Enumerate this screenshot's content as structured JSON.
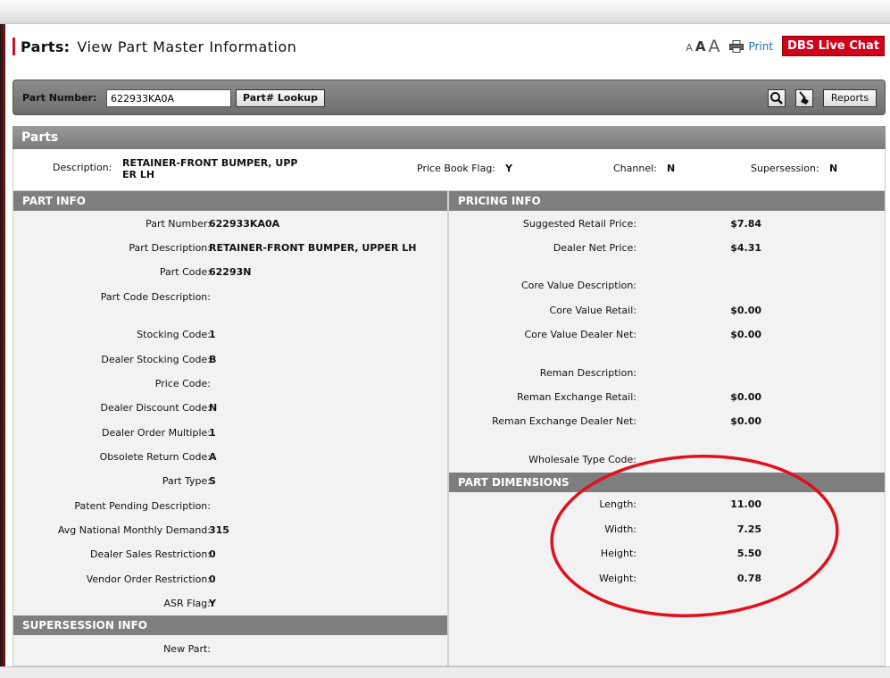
{
  "header": {
    "title_bold": "Parts:",
    "title_rest": "View Part Master Information",
    "font_sizes": [
      "A",
      "A",
      "A"
    ],
    "print_label": "Print",
    "chat_label": "DBS Live Chat"
  },
  "search": {
    "part_number_label": "Part Number:",
    "part_number_value": "622933KA0A",
    "lookup_label": "Part# Lookup",
    "reports_label": "Reports"
  },
  "parts_section_title": "Parts",
  "summary": {
    "description_label": "Description:",
    "description_line1": "RETAINER-FRONT BUMPER, UPP",
    "description_line2": "ER LH",
    "price_book_flag_label": "Price Book Flag:",
    "price_book_flag_value": "Y",
    "channel_label": "Channel:",
    "channel_value": "N",
    "supersession_label": "Supersession:",
    "supersession_value": "N"
  },
  "part_info": {
    "title": "PART INFO",
    "rows": [
      {
        "label": "Part Number:",
        "value": "622933KA0A"
      },
      {
        "label": "Part Description:",
        "value": "RETAINER-FRONT BUMPER, UPPER LH"
      },
      {
        "label": "Part Code:",
        "value": "62293N"
      },
      {
        "label": "Part Code Description:",
        "value": ""
      },
      {
        "label": "Stocking Code:",
        "value": "1"
      },
      {
        "label": "Dealer Stocking Code:",
        "value": "B"
      },
      {
        "label": "Price Code:",
        "value": ""
      },
      {
        "label": "Dealer Discount Code:",
        "value": "N"
      },
      {
        "label": "Dealer Order Multiple:",
        "value": "1"
      },
      {
        "label": "Obsolete Return Code:",
        "value": "A"
      },
      {
        "label": "Part Type:",
        "value": "S"
      },
      {
        "label": "Patent Pending Description:",
        "value": ""
      },
      {
        "label": "Avg National Monthly Demand:",
        "value": "315"
      },
      {
        "label": "Dealer Sales Restriction:",
        "value": "0"
      },
      {
        "label": "Vendor Order Restriction:",
        "value": "0"
      },
      {
        "label": "ASR Flag:",
        "value": "Y"
      }
    ]
  },
  "supersession_info": {
    "title": "SUPERSESSION INFO",
    "rows": [
      {
        "label": "New Part:",
        "value": ""
      }
    ]
  },
  "pricing_info": {
    "title": "PRICING INFO",
    "rows": [
      {
        "label": "Suggested Retail Price:",
        "value": "$7.84"
      },
      {
        "label": "Dealer Net Price:",
        "value": "$4.31"
      },
      {
        "label": "Core Value Description:",
        "value": ""
      },
      {
        "label": "Core Value Retail:",
        "value": "$0.00"
      },
      {
        "label": "Core Value Dealer Net:",
        "value": "$0.00"
      },
      {
        "label": "Reman Description:",
        "value": ""
      },
      {
        "label": "Reman Exchange Retail:",
        "value": "$0.00"
      },
      {
        "label": "Reman Exchange Dealer Net:",
        "value": "$0.00"
      },
      {
        "label": "Wholesale Type Code:",
        "value": ""
      }
    ]
  },
  "part_dimensions": {
    "title": "PART DIMENSIONS",
    "rows": [
      {
        "label": "Length:",
        "value": "11.00"
      },
      {
        "label": "Width:",
        "value": "7.25"
      },
      {
        "label": "Height:",
        "value": "5.50"
      },
      {
        "label": "Weight:",
        "value": "0.78"
      }
    ]
  },
  "colors": {
    "accent_red": "#d0021b",
    "annotation_red": "#e0101c",
    "panel_header": "#7e7e7e"
  }
}
